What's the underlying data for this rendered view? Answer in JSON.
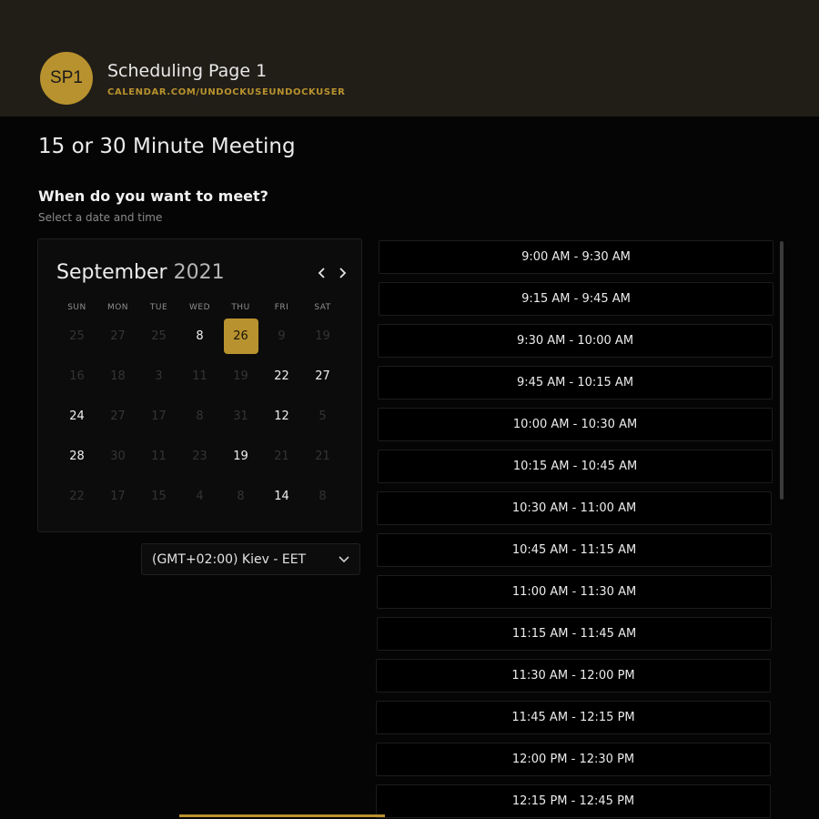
{
  "header": {
    "avatar_initials": "SP1",
    "page_name": "Scheduling Page 1",
    "page_url": "CALENDAR.COM/UNDOCKUSEUNDOCKUSER"
  },
  "meeting": {
    "title": "15 or 30 Minute Meeting",
    "question": "When do you want to meet?",
    "subtitle": "Select a date and time"
  },
  "calendar": {
    "month": "September",
    "year": "2021",
    "prev_icon": "chevron-left-icon",
    "next_icon": "chevron-right-icon",
    "weekdays": [
      "SUN",
      "MON",
      "TUE",
      "WED",
      "THU",
      "FRI",
      "SAT"
    ],
    "days": [
      {
        "label": "25",
        "available": false
      },
      {
        "label": "27",
        "available": false
      },
      {
        "label": "25",
        "available": false
      },
      {
        "label": "8",
        "available": true
      },
      {
        "label": "26",
        "available": true,
        "selected": true
      },
      {
        "label": "9",
        "available": false
      },
      {
        "label": "19",
        "available": false
      },
      {
        "label": "16",
        "available": false
      },
      {
        "label": "18",
        "available": false
      },
      {
        "label": "3",
        "available": false
      },
      {
        "label": "11",
        "available": false
      },
      {
        "label": "19",
        "available": false
      },
      {
        "label": "22",
        "available": true
      },
      {
        "label": "27",
        "available": true
      },
      {
        "label": "24",
        "available": true
      },
      {
        "label": "27",
        "available": false
      },
      {
        "label": "17",
        "available": false
      },
      {
        "label": "8",
        "available": false
      },
      {
        "label": "31",
        "available": false
      },
      {
        "label": "12",
        "available": true
      },
      {
        "label": "5",
        "available": false
      },
      {
        "label": "28",
        "available": true
      },
      {
        "label": "30",
        "available": false
      },
      {
        "label": "11",
        "available": false
      },
      {
        "label": "23",
        "available": false
      },
      {
        "label": "19",
        "available": true
      },
      {
        "label": "21",
        "available": false
      },
      {
        "label": "21",
        "available": false
      },
      {
        "label": "22",
        "available": false
      },
      {
        "label": "17",
        "available": false
      },
      {
        "label": "15",
        "available": false
      },
      {
        "label": "4",
        "available": false
      },
      {
        "label": "8",
        "available": false
      },
      {
        "label": "14",
        "available": true
      },
      {
        "label": "8",
        "available": false
      }
    ],
    "accent_color": "#b8922e"
  },
  "timezone": {
    "value": "(GMT+02:00) Kiev - EET",
    "icon": "chevron-down-icon"
  },
  "time_slots": [
    "9:00 AM - 9:30 AM",
    "9:15 AM - 9:45 AM",
    "9:30 AM - 10:00 AM",
    "9:45 AM - 10:15 AM",
    "10:00 AM - 10:30 AM",
    "10:15 AM - 10:45 AM",
    "10:30 AM - 11:00 AM",
    "10:45 AM - 11:15 AM",
    "11:00 AM - 11:30 AM",
    "11:15 AM - 11:45 AM",
    "11:30 AM - 12:00 PM",
    "11:45 AM - 12:15 PM",
    "12:00 PM - 12:30 PM",
    "12:15 PM - 12:45 PM"
  ]
}
